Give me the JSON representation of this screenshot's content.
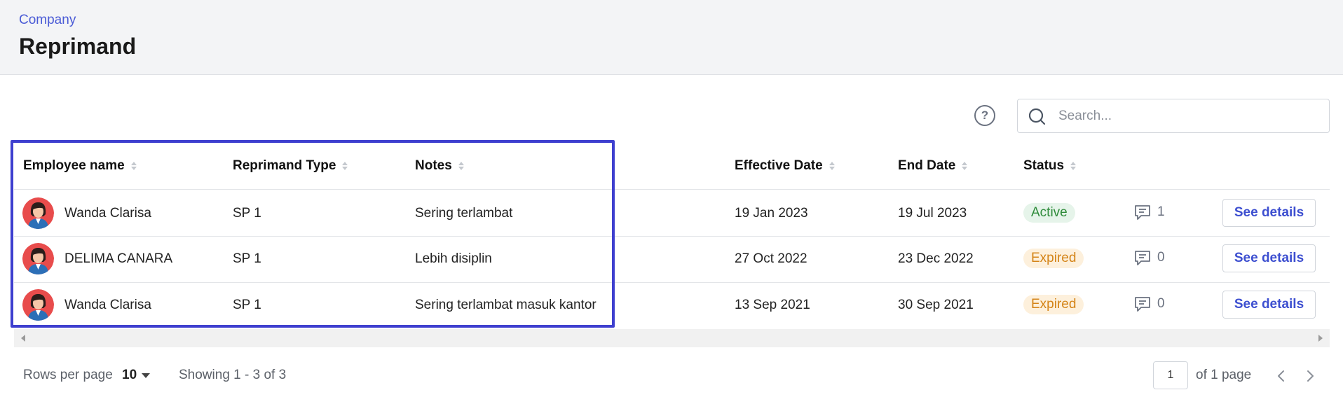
{
  "header": {
    "breadcrumb": "Company",
    "title": "Reprimand"
  },
  "toolbar": {
    "help_icon": "question-circle-icon",
    "help_glyph": "?",
    "search_placeholder": "Search..."
  },
  "table": {
    "columns": [
      "Employee name",
      "Reprimand Type",
      "Notes",
      "Effective Date",
      "End Date",
      "Status"
    ],
    "rows": [
      {
        "name": "Wanda Clarisa",
        "type": "SP 1",
        "notes": "Sering terlambat",
        "effective": "19 Jan 2023",
        "end": "19 Jul 2023",
        "status": "Active",
        "comments": "1",
        "action": "See details"
      },
      {
        "name": "DELIMA CANARA",
        "type": "SP 1",
        "notes": "Lebih disiplin",
        "effective": "27 Oct 2022",
        "end": "23 Dec 2022",
        "status": "Expired",
        "comments": "0",
        "action": "See details"
      },
      {
        "name": "Wanda Clarisa",
        "type": "SP 1",
        "notes": "Sering terlambat masuk kantor",
        "effective": "13 Sep 2021",
        "end": "30 Sep 2021",
        "status": "Expired",
        "comments": "0",
        "action": "See details"
      }
    ]
  },
  "footer": {
    "rows_per_page_label": "Rows per page",
    "rows_per_page_value": "10",
    "showing": "Showing 1 - 3 of 3",
    "current_page": "1",
    "page_total": "of 1 page"
  },
  "colors": {
    "accent": "#3d4fd0",
    "highlight": "#3e3fcf",
    "active_text": "#2e8b3a",
    "active_bg": "#e6f4ea",
    "expired_text": "#d48418",
    "expired_bg": "#fdf0dc"
  }
}
